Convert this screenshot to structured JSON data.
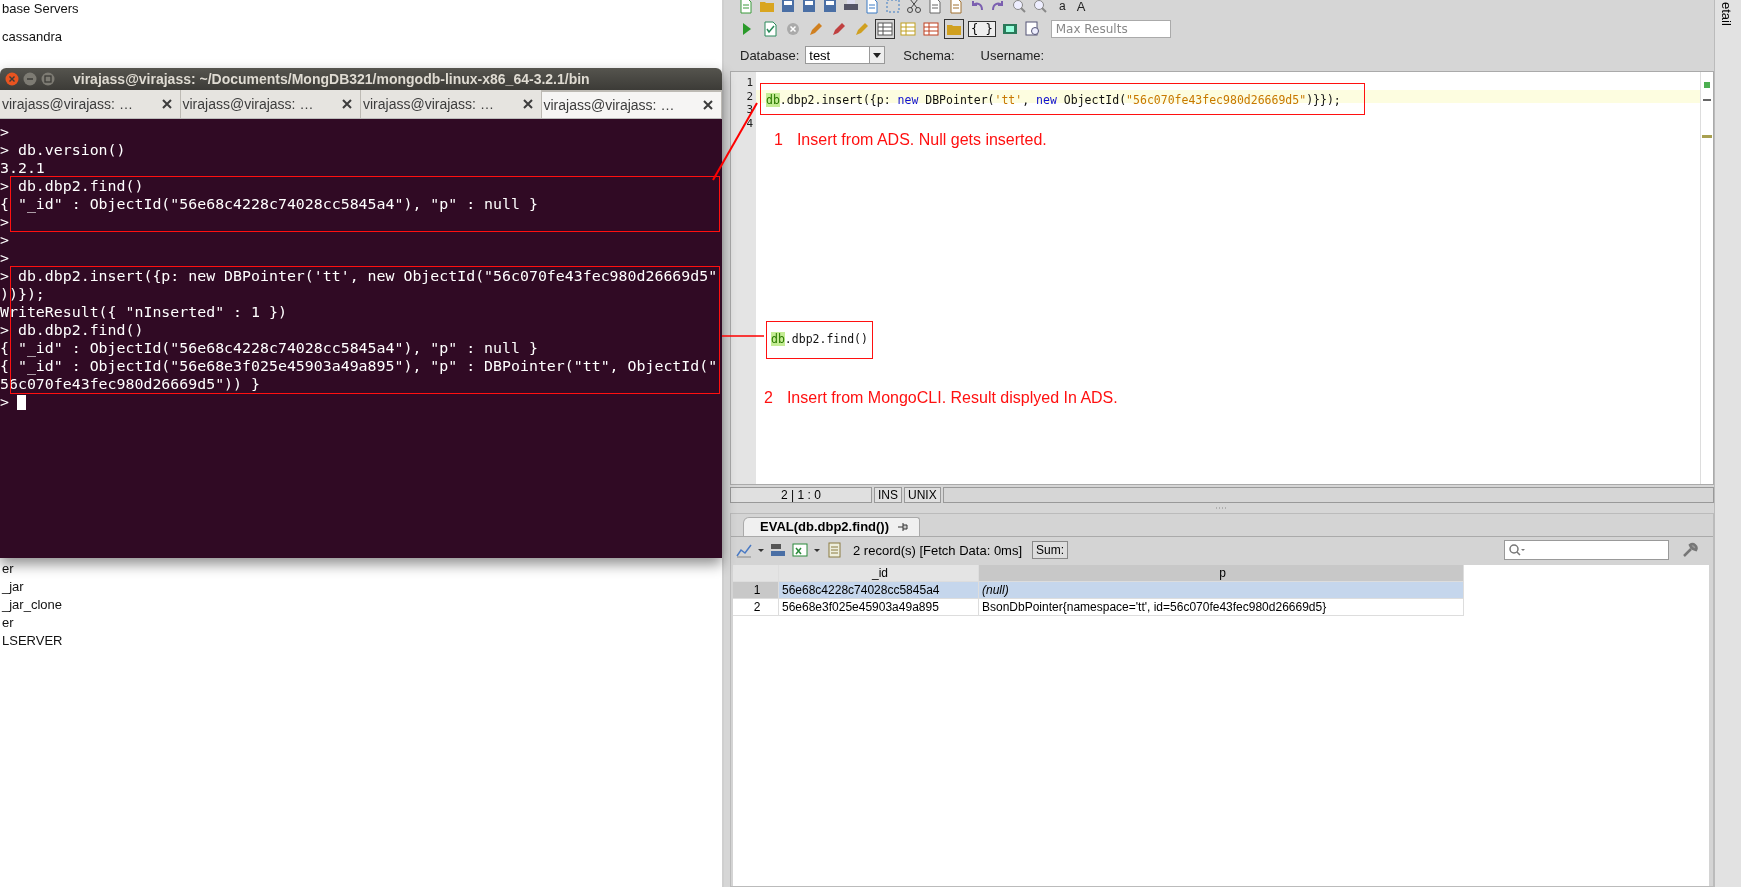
{
  "background_app": {
    "tree_items_top": [
      "base Servers",
      "cassandra"
    ],
    "tree_items_bottom": [
      "er",
      "_jar",
      "_jar_clone",
      "er",
      "LSERVER"
    ]
  },
  "terminal": {
    "title": "virajass@virajass: ~/Documents/MongDB321/mongodb-linux-x86_64-3.2.1/bin",
    "tabs": [
      {
        "label": "virajass@virajass: …",
        "selected": false
      },
      {
        "label": "virajass@virajass: …",
        "selected": false
      },
      {
        "label": "virajass@virajass: …",
        "selected": false
      },
      {
        "label": "virajass@virajass: …",
        "selected": true
      }
    ],
    "blocks": [
      {
        "highlighted": false,
        "lines": [
          ">",
          "> db.version()",
          "3.2.1"
        ]
      },
      {
        "highlighted": true,
        "lines": [
          "> db.dbp2.find()",
          "{ \"_id\" : ObjectId(\"56e68c4228c74028cc5845a4\"), \"p\" : null }",
          ">"
        ]
      },
      {
        "highlighted": false,
        "lines": [
          ">",
          ">"
        ]
      },
      {
        "highlighted": true,
        "lines": [
          "> db.dbp2.insert({p: new DBPointer('tt', new ObjectId(\"56c070fe43fec980d26669d5\"",
          "))});",
          "WriteResult({ \"nInserted\" : 1 })",
          "> db.dbp2.find()",
          "{ \"_id\" : ObjectId(\"56e68c4228c74028cc5845a4\"), \"p\" : null }",
          "{ \"_id\" : ObjectId(\"56e68e3f025e45903a49a895\"), \"p\" : DBPointer(\"tt\", ObjectId(\"",
          "56c070fe43fec980d26669d5\")) }"
        ]
      }
    ],
    "prompt": ">"
  },
  "toolbar": {
    "font_buttons": [
      "a",
      "A"
    ],
    "braces_button": "{ }",
    "max_results_placeholder": "Max Results"
  },
  "connection": {
    "database_label": "Database:",
    "database_value": "test",
    "schema_label": "Schema:",
    "username_label": "Username:"
  },
  "editor": {
    "lines": [
      {
        "number": "1",
        "current": false
      },
      {
        "number": "2",
        "current": true,
        "tokens": [
          {
            "text": "db",
            "kind": "object"
          },
          {
            "text": ".dbp2.insert({p: ",
            "kind": "plain"
          },
          {
            "text": "new",
            "kind": "keyword"
          },
          {
            "text": " DBPointer(",
            "kind": "plain"
          },
          {
            "text": "'tt'",
            "kind": "string"
          },
          {
            "text": ", ",
            "kind": "plain"
          },
          {
            "text": "new",
            "kind": "keyword"
          },
          {
            "text": " ObjectId(",
            "kind": "plain"
          },
          {
            "text": "\"56c070fe43fec980d26669d5\"",
            "kind": "string"
          },
          {
            "text": ")}});",
            "kind": "plain"
          }
        ]
      },
      {
        "number": "3",
        "current": false
      },
      {
        "number": "4",
        "current": false
      }
    ],
    "notes": [
      {
        "number": "1",
        "text": "Insert from ADS. Null gets inserted."
      },
      {
        "number": "2",
        "text": "Insert from MongoCLI. Result displyed In ADS."
      }
    ],
    "snippet": [
      {
        "text": "db",
        "kind": "object"
      },
      {
        "text": ".dbp2.find()",
        "kind": "plain"
      }
    ]
  },
  "status_bar": [
    "2 | 1 : 0",
    "INS",
    "UNIX"
  ],
  "results": {
    "tab_label": "EVAL(db.dbp2.find())",
    "record_count": "2 record(s) [Fetch Data: 0ms]",
    "sum_button": "Sum:",
    "columns": [
      "_id",
      "p"
    ],
    "rows": [
      {
        "number": "1",
        "selected": true,
        "cells": [
          {
            "text": "56e68c4228c74028cc5845a4",
            "kind": "value"
          },
          {
            "text": "(null)",
            "kind": "null"
          }
        ]
      },
      {
        "number": "2",
        "selected": false,
        "cells": [
          {
            "text": "56e68e3f025e45903a49a895",
            "kind": "value"
          },
          {
            "text": "BsonDbPointer{namespace='tt', id=56c070fe43fec980d26669d5}",
            "kind": "value"
          }
        ]
      }
    ]
  },
  "side_tab": "etail"
}
